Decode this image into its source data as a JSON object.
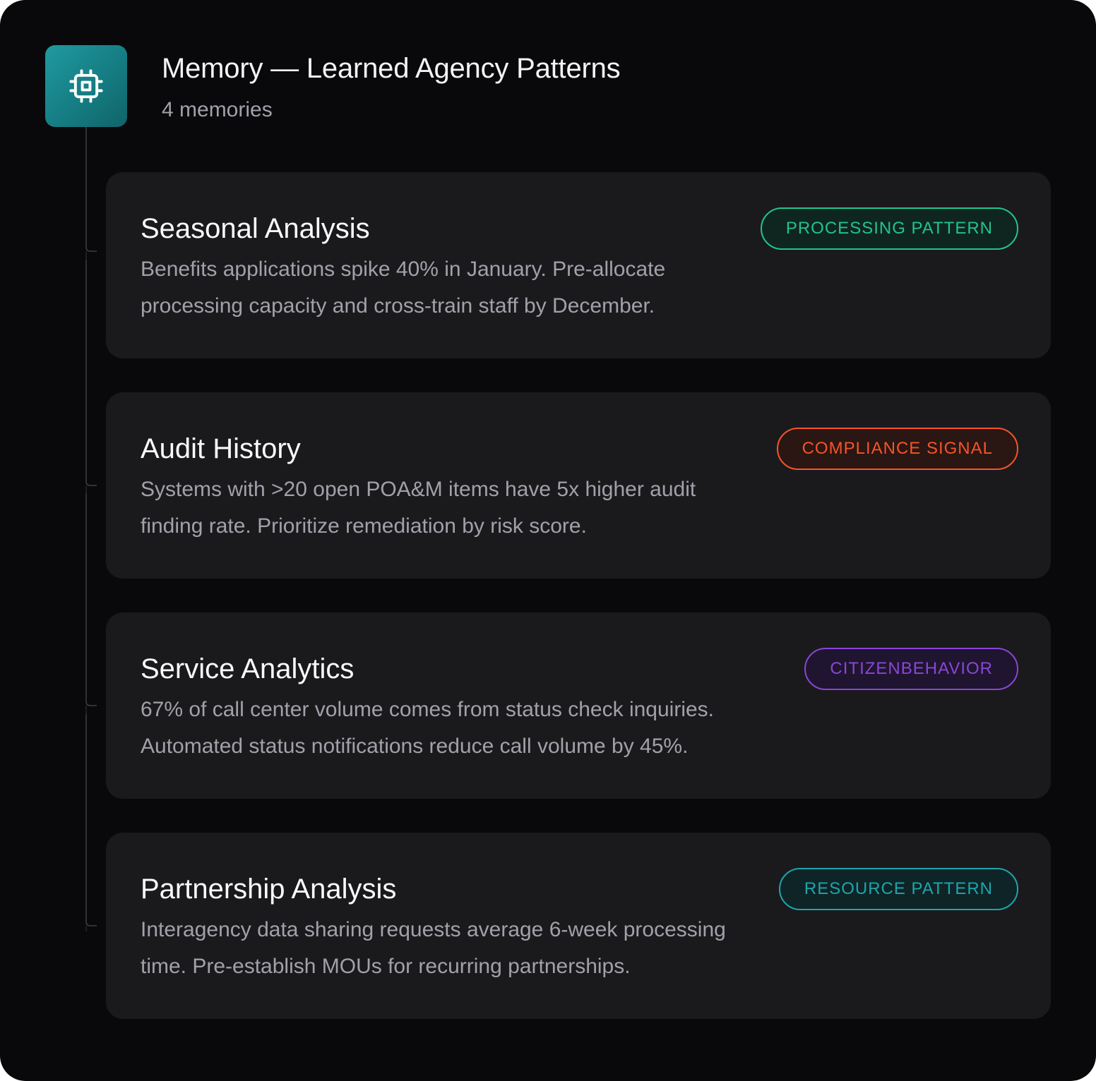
{
  "header": {
    "icon": "cpu-chip-icon",
    "title": "Memory — Learned Agency Patterns",
    "subtitle": "4 memories"
  },
  "memories": [
    {
      "title": "Seasonal Analysis",
      "description": "Benefits applications spike 40% in January. Pre-allocate processing capacity and cross-train staff by December.",
      "badge": "PROCESSING PATTERN",
      "badge_color": "#22c38e",
      "badge_bg": "#0f2620"
    },
    {
      "title": "Audit History",
      "description": "Systems with >20 open POA&M items have 5x higher audit finding rate. Prioritize remediation by risk score.",
      "badge": "COMPLIANCE SIGNAL",
      "badge_color": "#f5542a",
      "badge_bg": "#2a1612"
    },
    {
      "title": "Service Analytics",
      "description": "67% of call center volume comes from status check inquiries. Automated status notifications reduce call volume by 45%.",
      "badge": "CITIZENBEHAVIOR",
      "badge_color": "#8b45d6",
      "badge_bg": "#1f1530"
    },
    {
      "title": "Partnership Analysis",
      "description": "Interagency data sharing requests average 6-week processing time. Pre-establish MOUs for recurring partnerships.",
      "badge": "RESOURCE PATTERN",
      "badge_color": "#1da5ad",
      "badge_bg": "#0e2426"
    }
  ]
}
